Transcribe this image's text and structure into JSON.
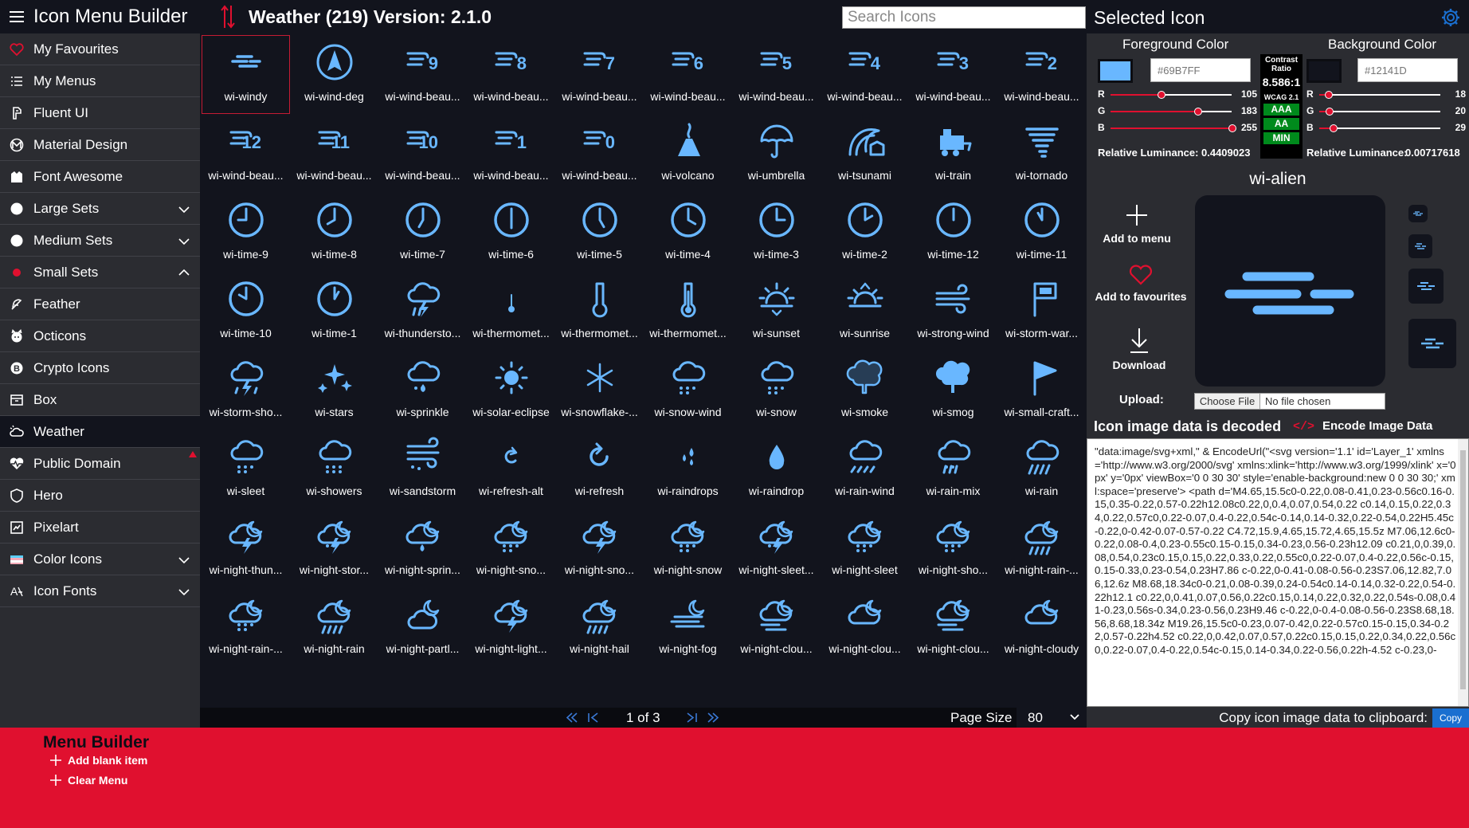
{
  "app": {
    "title": "Icon Menu Builder",
    "set_title": "Weather (219) Version: 2.1.0",
    "search_placeholder": "Search Icons",
    "panel_title": "Selected Icon"
  },
  "colors": {
    "accent": "#69B7FF",
    "background": "#12141D",
    "sidebar": "#2B2C31",
    "builder": "#E0102F",
    "heart": "#E0102F"
  },
  "sidebar": {
    "items": [
      {
        "label": "My Favourites",
        "icon": "heart-icon"
      },
      {
        "label": "My Menus",
        "icon": "list-icon"
      },
      {
        "label": "Fluent UI",
        "icon": "fluent-icon"
      },
      {
        "label": "Material Design",
        "icon": "material-icon"
      },
      {
        "label": "Font Awesome",
        "icon": "flag-icon"
      },
      {
        "label": "Large Sets",
        "icon": "circle-icon",
        "chevron": "down"
      },
      {
        "label": "Medium Sets",
        "icon": "circle-icon",
        "chevron": "down"
      },
      {
        "label": "Small Sets",
        "icon": "red-dot-icon",
        "chevron": "up"
      },
      {
        "label": "Feather",
        "icon": "feather-icon"
      },
      {
        "label": "Octicons",
        "icon": "octocat-icon"
      },
      {
        "label": "Crypto Icons",
        "icon": "bitcoin-icon"
      },
      {
        "label": "Box",
        "icon": "box-icon"
      },
      {
        "label": "Weather",
        "icon": "cloud-icon",
        "active": true
      },
      {
        "label": "Public Domain",
        "icon": "heart-pulse-icon",
        "badge": true
      },
      {
        "label": "Hero",
        "icon": "shield-icon"
      },
      {
        "label": "Pixelart",
        "icon": "pixel-icon"
      },
      {
        "label": "Color Icons",
        "icon": "flag-color-icon",
        "chevron": "down"
      },
      {
        "label": "Icon Fonts",
        "icon": "font-icon",
        "chevron": "down"
      }
    ]
  },
  "icons": [
    {
      "label": "wi-windy",
      "glyph": "windy"
    },
    {
      "label": "wi-wind-deg",
      "glyph": "deg"
    },
    {
      "label": "wi-wind-beau...",
      "glyph": "beau",
      "num": "9"
    },
    {
      "label": "wi-wind-beau...",
      "glyph": "beau",
      "num": "8"
    },
    {
      "label": "wi-wind-beau...",
      "glyph": "beau",
      "num": "7"
    },
    {
      "label": "wi-wind-beau...",
      "glyph": "beau",
      "num": "6"
    },
    {
      "label": "wi-wind-beau...",
      "glyph": "beau",
      "num": "5"
    },
    {
      "label": "wi-wind-beau...",
      "glyph": "beau",
      "num": "4"
    },
    {
      "label": "wi-wind-beau...",
      "glyph": "beau",
      "num": "3"
    },
    {
      "label": "wi-wind-beau...",
      "glyph": "beau",
      "num": "2"
    },
    {
      "label": "wi-wind-beau...",
      "glyph": "beau",
      "num": "12"
    },
    {
      "label": "wi-wind-beau...",
      "glyph": "beau",
      "num": "11"
    },
    {
      "label": "wi-wind-beau...",
      "glyph": "beau",
      "num": "10"
    },
    {
      "label": "wi-wind-beau...",
      "glyph": "beau",
      "num": "1"
    },
    {
      "label": "wi-wind-beau...",
      "glyph": "beau",
      "num": "0"
    },
    {
      "label": "wi-volcano",
      "glyph": "volcano"
    },
    {
      "label": "wi-umbrella",
      "glyph": "umbrella"
    },
    {
      "label": "wi-tsunami",
      "glyph": "tsunami"
    },
    {
      "label": "wi-train",
      "glyph": "train"
    },
    {
      "label": "wi-tornado",
      "glyph": "tornado"
    },
    {
      "label": "wi-time-9",
      "glyph": "clock",
      "hour": 9
    },
    {
      "label": "wi-time-8",
      "glyph": "clock",
      "hour": 8
    },
    {
      "label": "wi-time-7",
      "glyph": "clock",
      "hour": 7
    },
    {
      "label": "wi-time-6",
      "glyph": "clock",
      "hour": 6
    },
    {
      "label": "wi-time-5",
      "glyph": "clock",
      "hour": 5
    },
    {
      "label": "wi-time-4",
      "glyph": "clock",
      "hour": 4
    },
    {
      "label": "wi-time-3",
      "glyph": "clock",
      "hour": 3
    },
    {
      "label": "wi-time-2",
      "glyph": "clock",
      "hour": 2
    },
    {
      "label": "wi-time-12",
      "glyph": "clock",
      "hour": 12
    },
    {
      "label": "wi-time-11",
      "glyph": "clock",
      "hour": 11
    },
    {
      "label": "wi-time-10",
      "glyph": "clock",
      "hour": 10
    },
    {
      "label": "wi-time-1",
      "glyph": "clock",
      "hour": 1
    },
    {
      "label": "wi-thundersto...",
      "glyph": "thunder-rain"
    },
    {
      "label": "wi-thermomet...",
      "glyph": "thermo-small"
    },
    {
      "label": "wi-thermomet...",
      "glyph": "thermo-empty"
    },
    {
      "label": "wi-thermomet...",
      "glyph": "thermo"
    },
    {
      "label": "wi-sunset",
      "glyph": "sunset"
    },
    {
      "label": "wi-sunrise",
      "glyph": "sunrise"
    },
    {
      "label": "wi-strong-wind",
      "glyph": "strong-wind"
    },
    {
      "label": "wi-storm-war...",
      "glyph": "storm-flag"
    },
    {
      "label": "wi-storm-sho...",
      "glyph": "storm-showers"
    },
    {
      "label": "wi-stars",
      "glyph": "stars"
    },
    {
      "label": "wi-sprinkle",
      "glyph": "sprinkle"
    },
    {
      "label": "wi-solar-eclipse",
      "glyph": "eclipse"
    },
    {
      "label": "wi-snowflake-...",
      "glyph": "snowflake"
    },
    {
      "label": "wi-snow-wind",
      "glyph": "snow-cloud"
    },
    {
      "label": "wi-snow",
      "glyph": "snow-cloud"
    },
    {
      "label": "wi-smoke",
      "glyph": "smoke"
    },
    {
      "label": "wi-smog",
      "glyph": "smog"
    },
    {
      "label": "wi-small-craft...",
      "glyph": "flag"
    },
    {
      "label": "wi-sleet",
      "glyph": "sleet"
    },
    {
      "label": "wi-showers",
      "glyph": "showers"
    },
    {
      "label": "wi-sandstorm",
      "glyph": "sandstorm"
    },
    {
      "label": "wi-refresh-alt",
      "glyph": "refresh-small"
    },
    {
      "label": "wi-refresh",
      "glyph": "refresh"
    },
    {
      "label": "wi-raindrops",
      "glyph": "raindrops"
    },
    {
      "label": "wi-raindrop",
      "glyph": "raindrop"
    },
    {
      "label": "wi-rain-wind",
      "glyph": "rain-wind"
    },
    {
      "label": "wi-rain-mix",
      "glyph": "rain-mix"
    },
    {
      "label": "wi-rain",
      "glyph": "rain"
    },
    {
      "label": "wi-night-thun...",
      "glyph": "night-thunder"
    },
    {
      "label": "wi-night-stor...",
      "glyph": "night-storm"
    },
    {
      "label": "wi-night-sprin...",
      "glyph": "night-sprinkle"
    },
    {
      "label": "wi-night-sno...",
      "glyph": "night-snow"
    },
    {
      "label": "wi-night-sno...",
      "glyph": "night-thunder"
    },
    {
      "label": "wi-night-snow",
      "glyph": "night-snow"
    },
    {
      "label": "wi-night-sleet...",
      "glyph": "night-storm"
    },
    {
      "label": "wi-night-sleet",
      "glyph": "night-snow"
    },
    {
      "label": "wi-night-sho...",
      "glyph": "night-snow"
    },
    {
      "label": "wi-night-rain-...",
      "glyph": "night-rain"
    },
    {
      "label": "wi-night-rain-...",
      "glyph": "night-snow"
    },
    {
      "label": "wi-night-rain",
      "glyph": "night-rain"
    },
    {
      "label": "wi-night-partl...",
      "glyph": "night-partly"
    },
    {
      "label": "wi-night-light...",
      "glyph": "night-thunder"
    },
    {
      "label": "wi-night-hail",
      "glyph": "night-rain"
    },
    {
      "label": "wi-night-fog",
      "glyph": "night-fog"
    },
    {
      "label": "wi-night-clou...",
      "glyph": "night-cloud-wind"
    },
    {
      "label": "wi-night-clou...",
      "glyph": "night-cloud-outline"
    },
    {
      "label": "wi-night-clou...",
      "glyph": "night-cloud-wind"
    },
    {
      "label": "wi-night-cloudy",
      "glyph": "night-cloud-outline"
    }
  ],
  "pager": {
    "page_text": "1 of 3",
    "page_size_label": "Page Size",
    "page_size_value": "80"
  },
  "panel": {
    "fg": {
      "label": "Foreground Color",
      "hex": "#69B7FF",
      "r": 105,
      "g": 183,
      "b": 255,
      "luminance_label": "Relative Luminance:",
      "luminance": "0.4409023"
    },
    "bg": {
      "label": "Background Color",
      "hex": "#12141D",
      "r": 18,
      "g": 20,
      "b": 29,
      "luminance_label": "Relative Luminance:",
      "luminance": "0.00717618"
    },
    "contrast": {
      "label_line1": "Contrast",
      "label_line2": "Ratio",
      "value": "8.586:1",
      "wcag": "WCAG 2.1",
      "aaa": "AAA",
      "aa": "AA",
      "min": "MIN"
    },
    "selected_name": "wi-alien",
    "add_to_menu": "Add to menu",
    "add_to_favourites": "Add to favourites",
    "download": "Download",
    "upload_label": "Upload:",
    "choose_file": "Choose File",
    "no_file": "No file chosen",
    "decoded_heading": "Icon image data is decoded",
    "encode_label": "Encode Image Data",
    "code": "\"data:image/svg+xml,\" & EncodeUrl(\"<svg version='1.1' id='Layer_1' xmlns='http://www.w3.org/2000/svg' xmlns:xlink='http://www.w3.org/1999/xlink' x='0px' y='0px' viewBox='0 0 30 30' style='enable-background:new 0 0 30 30;' xml:space='preserve'> <path d='M4.65,15.5c0-0.22,0.08-0.41,0.23-0.56c0.16-0.15,0.35-0.22,0.57-0.22h12.08c0.22,0,0.4,0.07,0.54,0.22 c0.14,0.15,0.22,0.34,0.22,0.57c0,0.22-0.07,0.4-0.22,0.54c-0.14,0.14-0.32,0.22-0.54,0.22H5.45c-0.22,0-0.42-0.07-0.57-0.22 C4.72,15.9,4.65,15.72,4.65,15.5z M7.06,12.6c0-0.22,0.08-0.4,0.23-0.55c0.15-0.15,0.34-0.23,0.56-0.23h12.09 c0.21,0,0.39,0.08,0.54,0.23c0.15,0.15,0.22,0.33,0.22,0.55c0,0.22-0.07,0.4-0.22,0.56c-0.15,0.15-0.33,0.23-0.54,0.23H7.86 c-0.22,0-0.41-0.08-0.56-0.23S7.06,12.82,7.06,12.6z M8.68,18.34c0-0.21,0.08-0.39,0.24-0.54c0.14-0.14,0.32-0.22,0.54-0.22h12.1 c0.22,0,0.41,0.07,0.56,0.22c0.15,0.14,0.22,0.32,0.22,0.54s-0.08,0.41-0.23,0.56s-0.34,0.23-0.56,0.23H9.46 c-0.22,0-0.4-0.08-0.56-0.23S8.68,18.56,8.68,18.34z M19.26,15.5c0-0.23,0.07-0.42,0.22-0.57c0.15-0.15,0.34-0.22,0.57-0.22h4.52 c0.22,0,0.42,0.07,0.57,0.22c0.15,0.15,0.22,0.34,0.22,0.56c0,0.22-0.07,0.4-0.22,0.54c-0.15,0.14-0.34,0.22-0.56,0.22h-4.52 c-0.23,0-",
    "copy_label": "Copy icon image data to clipboard:",
    "copy_button": "Copy"
  },
  "builder": {
    "title": "Menu Builder",
    "add_blank": "Add blank item",
    "clear_menu": "Clear Menu"
  }
}
